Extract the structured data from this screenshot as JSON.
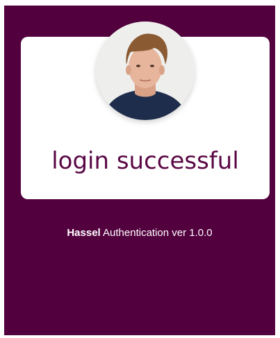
{
  "login": {
    "message": "login successful",
    "avatar_icon": "user-photo",
    "background_color": "#53003e",
    "accent_text_color": "#5a0845"
  },
  "footer": {
    "brand": "Hassel",
    "text": "Authentication ver 1.0.0"
  }
}
